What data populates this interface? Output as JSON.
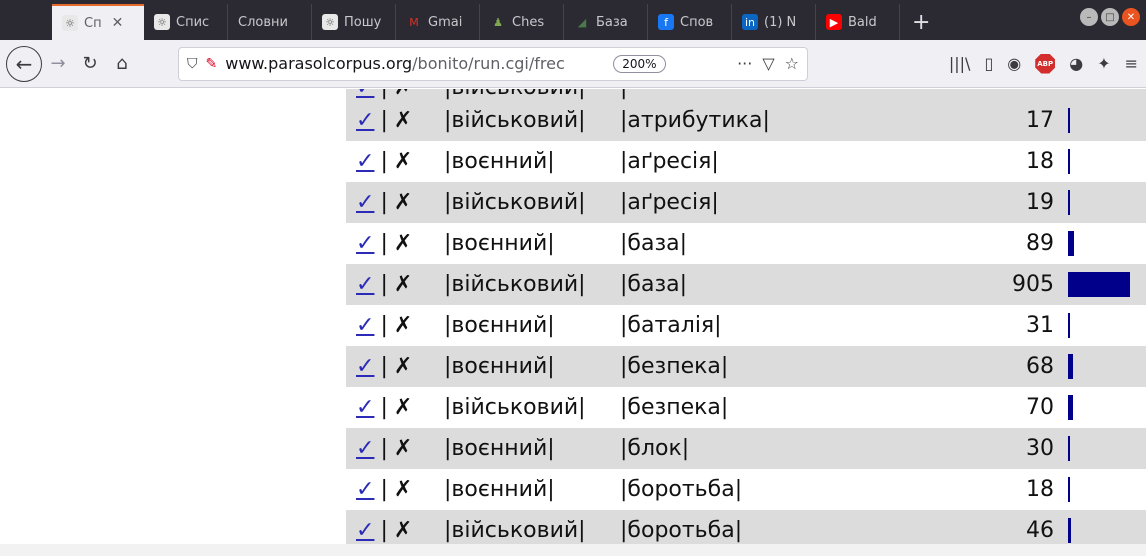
{
  "tabs": [
    {
      "favicon": "bonito-icon",
      "title": "Сп",
      "active": true
    },
    {
      "favicon": "bonito-icon",
      "title": "Спис",
      "active": false
    },
    {
      "favicon": "",
      "title": "Словни",
      "active": false
    },
    {
      "favicon": "bonito-icon",
      "title": "Пошу",
      "active": false
    },
    {
      "favicon": "gmail-icon",
      "title": "Gmai",
      "active": false
    },
    {
      "favicon": "chess-icon",
      "title": "Ches",
      "active": false
    },
    {
      "favicon": "database-icon",
      "title": "База",
      "active": false
    },
    {
      "favicon": "facebook-icon",
      "title": "Спов",
      "active": false
    },
    {
      "favicon": "linkedin-icon",
      "title": "(1) N",
      "active": false
    },
    {
      "favicon": "youtube-icon",
      "title": "Bald",
      "active": false
    }
  ],
  "newtab": "+",
  "url": {
    "domain": "www.parasolcorpus.org",
    "path": "/bonito/run.cgi/frec",
    "zoom": "200%"
  },
  "table": {
    "partial_row": {
      "word1": "|військовий|",
      "word2": "|",
      "freq": ""
    },
    "check_symbol": "✓",
    "cross_symbol": "✗",
    "separator": "|",
    "bar_color": "#00008b",
    "rows": [
      {
        "word1": "|військовий|",
        "word2": "|атрибутика|",
        "freq": "17",
        "count": 17
      },
      {
        "word1": "|воєнний|",
        "word2": "|аґресія|",
        "freq": "18",
        "count": 18
      },
      {
        "word1": "|військовий|",
        "word2": "|аґресія|",
        "freq": "19",
        "count": 19
      },
      {
        "word1": "|воєнний|",
        "word2": "|база|",
        "freq": "89",
        "count": 89
      },
      {
        "word1": "|військовий|",
        "word2": "|база|",
        "freq": "905",
        "count": 905
      },
      {
        "word1": "|воєнний|",
        "word2": "|баталія|",
        "freq": "31",
        "count": 31
      },
      {
        "word1": "|воєнний|",
        "word2": "|безпека|",
        "freq": "68",
        "count": 68
      },
      {
        "word1": "|військовий|",
        "word2": "|безпека|",
        "freq": "70",
        "count": 70
      },
      {
        "word1": "|воєнний|",
        "word2": "|блок|",
        "freq": "30",
        "count": 30
      },
      {
        "word1": "|воєнний|",
        "word2": "|боротьба|",
        "freq": "18",
        "count": 18
      },
      {
        "word1": "|військовий|",
        "word2": "|боротьба|",
        "freq": "46",
        "count": 46
      }
    ]
  }
}
